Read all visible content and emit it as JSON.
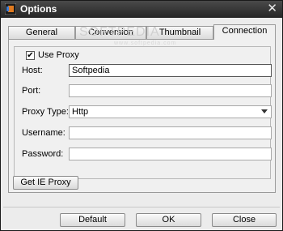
{
  "window": {
    "title": "Options"
  },
  "tabs": [
    {
      "label": "General"
    },
    {
      "label": "Conversion"
    },
    {
      "label": "Thumbnail"
    },
    {
      "label": "Connection",
      "active": true
    }
  ],
  "watermark": {
    "text": "SOFTPEDIA",
    "sub": "www.softpedia.com"
  },
  "proxy": {
    "use_proxy_label": "Use Proxy",
    "use_proxy_checked": true,
    "host_label": "Host:",
    "host_value": "Softpedia",
    "port_label": "Port:",
    "port_value": "",
    "type_label": "Proxy Type:",
    "type_value": "Http",
    "username_label": "Username:",
    "username_value": "",
    "password_label": "Password:",
    "password_value": ""
  },
  "buttons": {
    "get_ie_proxy": "Get IE Proxy",
    "default": "Default",
    "ok": "OK",
    "close": "Close"
  },
  "icons": {
    "check": "✔",
    "close": "✕"
  }
}
